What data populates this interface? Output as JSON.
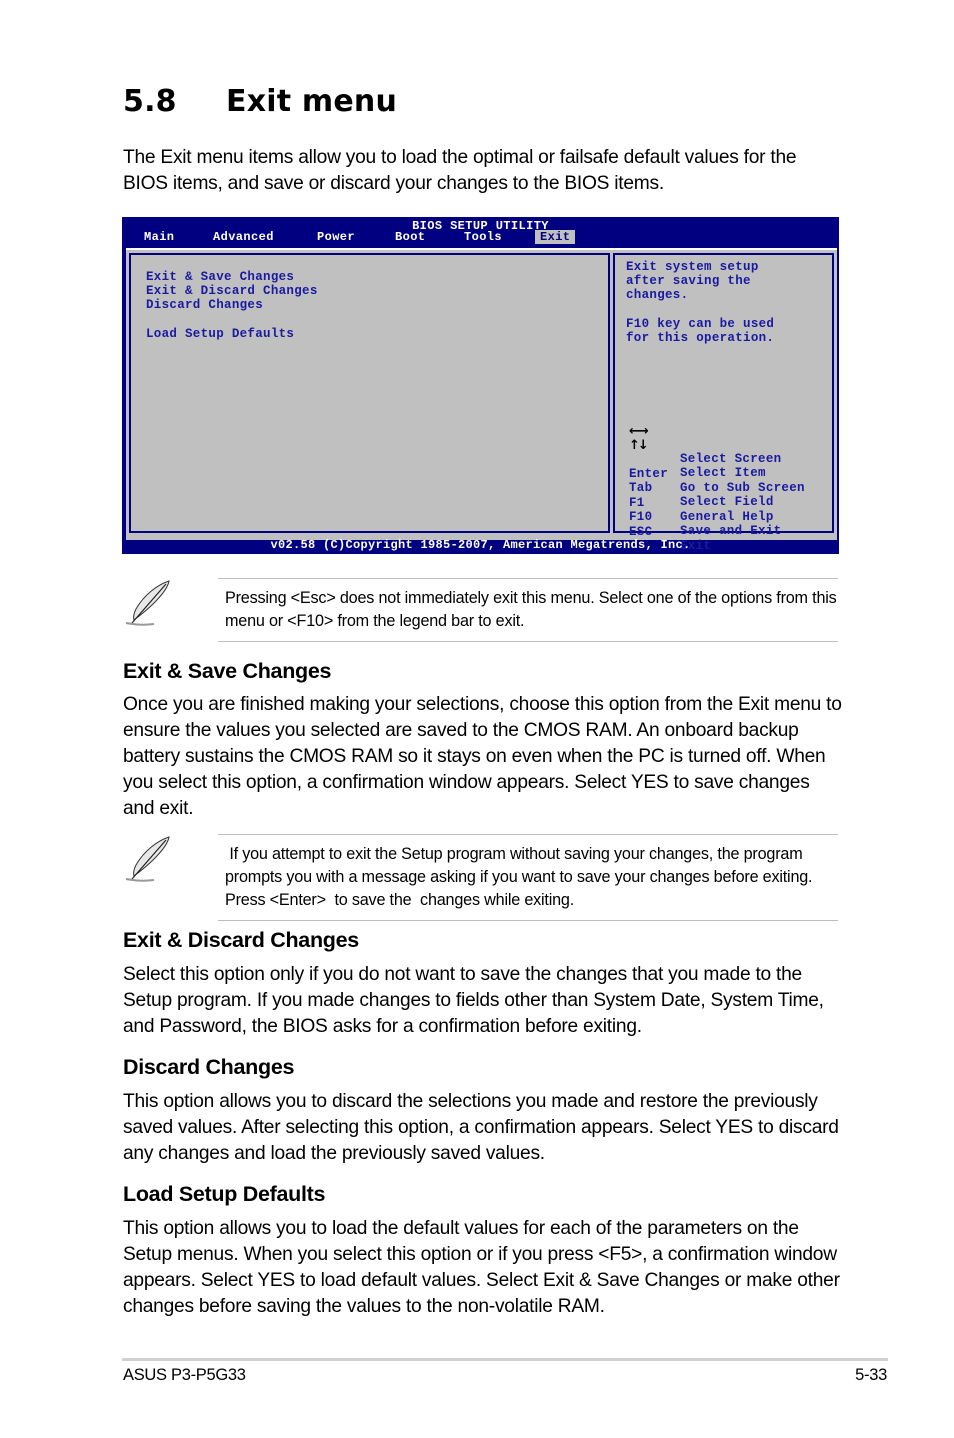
{
  "section": {
    "number": "5.8",
    "title": "Exit menu",
    "intro": "The Exit menu items allow you to load the optimal or failsafe default values for the BIOS items, and save or discard your changes to the BIOS items."
  },
  "bios": {
    "title": "BIOS SETUP UTILITY",
    "tabs": [
      {
        "label": "Main"
      },
      {
        "label": "Advanced"
      },
      {
        "label": "Power"
      },
      {
        "label": "Boot"
      },
      {
        "label": "Tools"
      },
      {
        "label": "Exit",
        "active": true
      }
    ],
    "menu_items": [
      "Exit & Save Changes",
      "Exit & Discard Changes",
      "Discard Changes",
      "Load Setup Defaults"
    ],
    "help_text": [
      "Exit system setup",
      "after saving the",
      "changes.",
      "F10 key can be used",
      "for this operation."
    ],
    "legend": [
      {
        "key": "left-right-arrows-icon",
        "desc": "Select Screen"
      },
      {
        "key": "up-down-arrows-icon",
        "desc": "Select Item"
      },
      {
        "key": "Enter",
        "desc": "Go to Sub Screen"
      },
      {
        "key": "Tab",
        "desc": "Select Field"
      },
      {
        "key": "F1",
        "desc": "General Help"
      },
      {
        "key": "F10",
        "desc": "Save and Exit"
      },
      {
        "key": "ESC",
        "desc": "Exit"
      }
    ],
    "footer": "v02.58 (C)Copyright 1985-2007, American Megatrends, Inc.",
    "colors": {
      "frame": "#000080",
      "panel": "#c0c0c0",
      "text": "#1a1aa0",
      "header_text": "#ffffff"
    }
  },
  "notes": [
    {
      "icon": "feather-pen-icon",
      "text": "Pressing <Esc> does not immediately exit this menu. Select one of the options from this menu or <F10> from the legend bar to exit."
    },
    {
      "icon": "feather-pen-icon",
      "text": " If you attempt to exit the Setup program without saving your changes, the program prompts you with a message asking if you want to save your changes before exiting. Press <Enter>  to save the  changes while exiting."
    }
  ],
  "subsections": [
    {
      "heading": "Exit & Save Changes",
      "body": "Once you are finished making your selections, choose this option from the Exit menu to ensure the values you selected are saved to the CMOS RAM. An onboard backup battery sustains the CMOS RAM so it stays on even when the PC is turned off. When you select this option, a confirmation window appears. Select YES to save changes and exit."
    },
    {
      "heading": "Exit & Discard Changes",
      "body": "Select this option only if you do not want to save the changes that you  made to the Setup program. If you made changes to fields other than System Date, System Time, and Password, the BIOS asks for a confirmation before exiting."
    },
    {
      "heading": "Discard Changes",
      "body": "This option allows you to discard the selections you made and restore the previously saved values. After selecting this option, a confirmation appears. Select YES to discard any changes and load the previously saved values."
    },
    {
      "heading": "Load Setup Defaults",
      "body": "This option allows you to load the default values for each of the parameters on the Setup menus. When you select this option or if you press <F5>, a confirmation window appears. Select YES to load default values. Select Exit & Save Changes or make other changes before saving the values to the non-volatile RAM."
    }
  ],
  "page_footer": {
    "product": "ASUS P3-P5G33",
    "page": "5-33"
  }
}
